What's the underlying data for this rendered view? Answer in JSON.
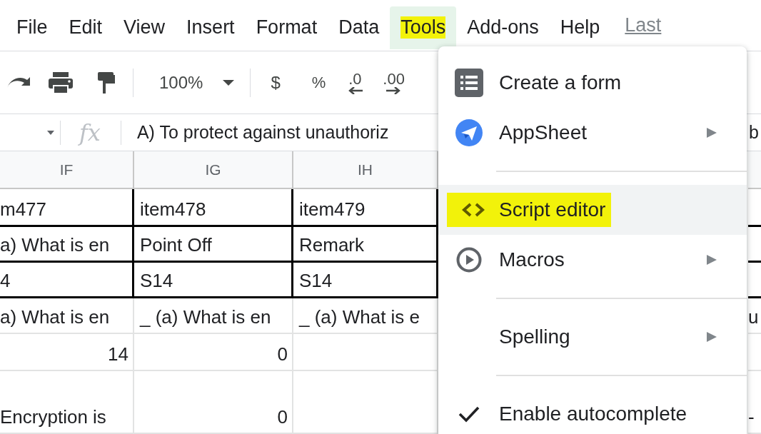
{
  "menu_bar": {
    "items": [
      {
        "label": "File",
        "selected": false,
        "highlighted": false
      },
      {
        "label": "Edit",
        "selected": false,
        "highlighted": false
      },
      {
        "label": "View",
        "selected": false,
        "highlighted": false
      },
      {
        "label": "Insert",
        "selected": false,
        "highlighted": false
      },
      {
        "label": "Format",
        "selected": false,
        "highlighted": false
      },
      {
        "label": "Data",
        "selected": false,
        "highlighted": false
      },
      {
        "label": "Tools",
        "selected": true,
        "highlighted": true
      },
      {
        "label": "Add-ons",
        "selected": false,
        "highlighted": false
      },
      {
        "label": "Help",
        "selected": false,
        "highlighted": false
      }
    ],
    "last_edit": "Last"
  },
  "toolbar": {
    "zoom": "100%",
    "currency": "$",
    "percent": "%",
    "decrease_decimal": ".0",
    "increase_decimal": ".00"
  },
  "formula_bar": {
    "fx": "fx",
    "content": "A) To protect against unauthoriz",
    "content_tail": "b"
  },
  "sheet": {
    "columns": [
      "IF",
      "IG",
      "IH"
    ],
    "rows": [
      {
        "bordered": true,
        "cells": [
          {
            "text": "m477",
            "kind": "text"
          },
          {
            "text": "item478",
            "kind": "text"
          },
          {
            "text": "item479",
            "kind": "text"
          }
        ]
      },
      {
        "bordered": true,
        "cells": [
          {
            "text": "a) What is en",
            "kind": "text"
          },
          {
            "text": "Point Off",
            "kind": "text"
          },
          {
            "text": "Remark",
            "kind": "text"
          }
        ]
      },
      {
        "bordered": true,
        "cells": [
          {
            "text": "4",
            "kind": "text"
          },
          {
            "text": "S14",
            "kind": "text"
          },
          {
            "text": "S14",
            "kind": "text"
          }
        ]
      },
      {
        "bordered": false,
        "cells": [
          {
            "text": "a) What is en",
            "kind": "text"
          },
          {
            "text": "_ (a) What is en",
            "kind": "text"
          },
          {
            "text": "_ (a) What is e",
            "kind": "text"
          }
        ],
        "edge": "u"
      },
      {
        "bordered": false,
        "cells": [
          {
            "text": "14",
            "kind": "number"
          },
          {
            "text": "0",
            "kind": "number"
          },
          null
        ]
      },
      {
        "bordered": false,
        "cells": [
          {
            "text": "Encryption is",
            "kind": "text"
          },
          {
            "text": "0",
            "kind": "number"
          },
          null
        ],
        "edge": "-"
      }
    ]
  },
  "tools_menu": {
    "items": [
      {
        "kind": "item",
        "label": "Create a form",
        "has_submenu": false,
        "checked": false,
        "hovered": false,
        "highlighted": false
      },
      {
        "kind": "item",
        "label": "AppSheet",
        "has_submenu": true,
        "checked": false,
        "hovered": false,
        "highlighted": false
      },
      {
        "kind": "separator"
      },
      {
        "kind": "item",
        "label": "Script editor",
        "has_submenu": false,
        "checked": false,
        "hovered": true,
        "highlighted": true
      },
      {
        "kind": "item",
        "label": "Macros",
        "has_submenu": true,
        "checked": false,
        "hovered": false,
        "highlighted": false
      },
      {
        "kind": "separator"
      },
      {
        "kind": "item",
        "label": "Spelling",
        "has_submenu": true,
        "checked": false,
        "hovered": false,
        "highlighted": false
      },
      {
        "kind": "separator"
      },
      {
        "kind": "item",
        "label": "Enable autocomplete",
        "has_submenu": false,
        "checked": true,
        "hovered": false,
        "highlighted": false
      }
    ]
  }
}
